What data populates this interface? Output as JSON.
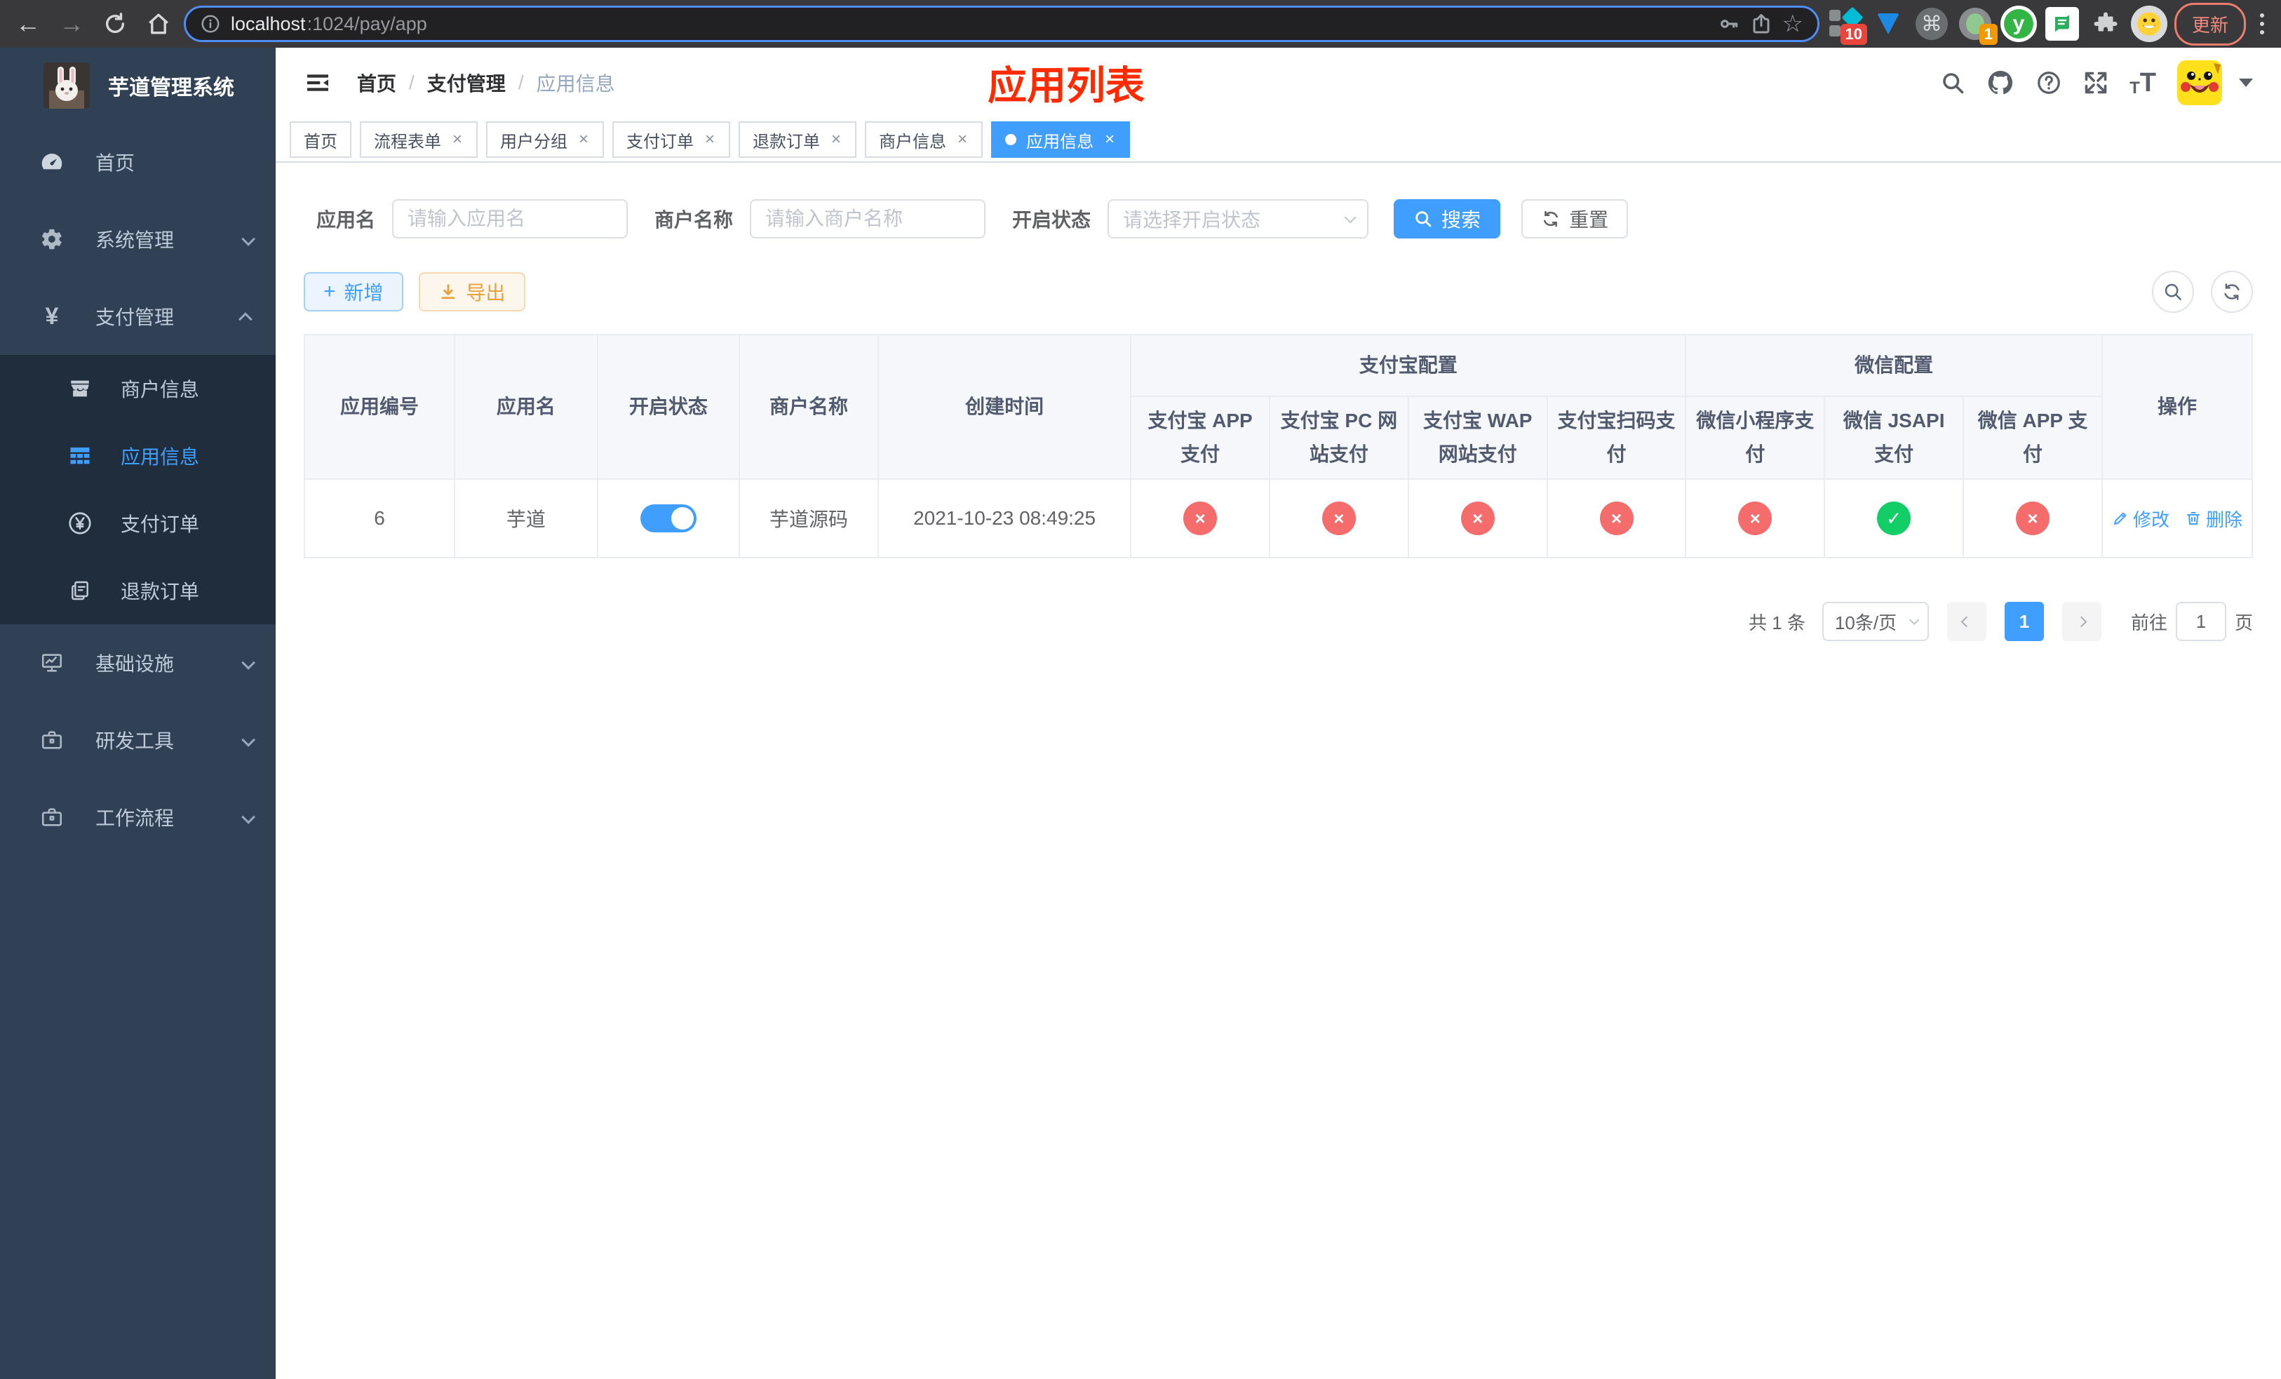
{
  "browser": {
    "url_host": "localhost",
    "url_rest": ":1024/pay/app",
    "update_label": "更新",
    "ext_badge_sketch": "10",
    "ext_badge_rec": "1",
    "ext_y_label": "y"
  },
  "icons": {
    "back": "←",
    "forward": "→",
    "star": "☆",
    "close": "×",
    "check": "✓",
    "cross": "×",
    "cmd": "⌘",
    "plus": "+",
    "yen": "¥",
    "t_small": "T",
    "t_big": "T"
  },
  "sidebar": {
    "title": "芋道管理系统",
    "menu": [
      {
        "label": "首页"
      },
      {
        "label": "系统管理"
      },
      {
        "label": "支付管理"
      },
      {
        "label": "基础设施"
      },
      {
        "label": "研发工具"
      },
      {
        "label": "工作流程"
      }
    ],
    "submenu": [
      {
        "label": "商户信息"
      },
      {
        "label": "应用信息"
      },
      {
        "label": "支付订单"
      },
      {
        "label": "退款订单"
      }
    ]
  },
  "header": {
    "breadcrumb": [
      "首页",
      "支付管理",
      "应用信息"
    ],
    "separator": "/",
    "annotation": "应用列表"
  },
  "tabs": [
    {
      "label": "首页"
    },
    {
      "label": "流程表单"
    },
    {
      "label": "用户分组"
    },
    {
      "label": "支付订单"
    },
    {
      "label": "退款订单"
    },
    {
      "label": "商户信息"
    },
    {
      "label": "应用信息"
    }
  ],
  "filters": {
    "app_name": {
      "label": "应用名",
      "placeholder": "请输入应用名",
      "value": ""
    },
    "merchant": {
      "label": "商户名称",
      "placeholder": "请输入商户名称",
      "value": ""
    },
    "status": {
      "label": "开启状态",
      "placeholder": "请选择开启状态"
    },
    "search": "搜索",
    "reset": "重置"
  },
  "toolbar": {
    "add": "新增",
    "export": "导出"
  },
  "table": {
    "groups": {
      "alipay": "支付宝配置",
      "wechat": "微信配置"
    },
    "columns": {
      "id": "应用编号",
      "name": "应用名",
      "status": "开启状态",
      "merchant": "商户名称",
      "created": "创建时间",
      "alipay_app": "支付宝 APP 支付",
      "alipay_pc": "支付宝 PC 网站支付",
      "alipay_wap": "支付宝 WAP 网站支付",
      "alipay_qr": "支付宝扫码支付",
      "wx_lite": "微信小程序支付",
      "wx_jsapi": "微信 JSAPI 支付",
      "wx_app": "微信 APP 支付",
      "actions": "操作"
    },
    "row": {
      "id": "6",
      "name": "芋道",
      "status_on": true,
      "merchant": "芋道源码",
      "created": "2021-10-23 08:49:25",
      "channels": [
        false,
        false,
        false,
        false,
        false,
        true,
        false
      ],
      "edit": "修改",
      "delete": "删除"
    }
  },
  "pagination": {
    "total": "共 1 条",
    "size": "10条/页",
    "page": "1",
    "goto": "前往",
    "goto_value": "1",
    "unit": "页"
  },
  "colors": {
    "primary": "#409eff",
    "success_circle": "#13ce66",
    "fail_circle": "#f56c6c",
    "sidebar_bg": "#304156",
    "submenu_bg": "#1f2d3d",
    "annotation_red": "#fe2b00"
  }
}
